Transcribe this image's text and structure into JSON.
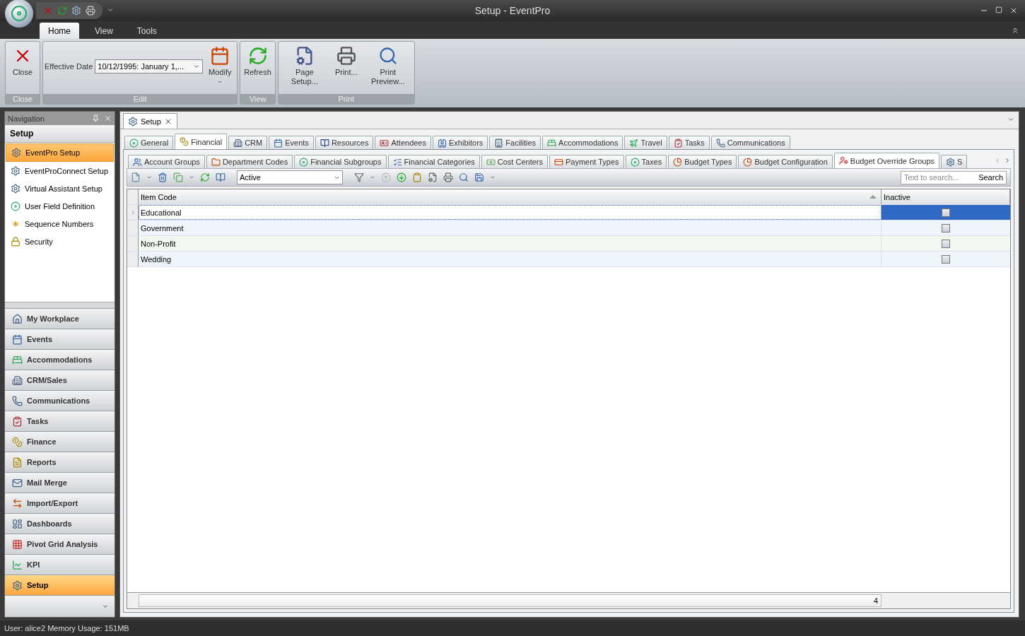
{
  "window": {
    "title": "Setup - EventPro"
  },
  "ribbon": {
    "tabs": [
      {
        "label": "Home",
        "selected": true
      },
      {
        "label": "View",
        "selected": false
      },
      {
        "label": "Tools",
        "selected": false
      }
    ],
    "groups": [
      {
        "caption": "Close",
        "items": [
          {
            "kind": "button",
            "label": "Close"
          }
        ]
      },
      {
        "caption": "Edit",
        "items": [
          {
            "kind": "date",
            "label": "Effective Date",
            "value": "10/12/1995: January 1,..."
          },
          {
            "kind": "button",
            "label": "Modify",
            "dropdown": true
          }
        ]
      },
      {
        "caption": "View",
        "items": [
          {
            "kind": "button",
            "label": "Refresh"
          }
        ]
      },
      {
        "caption": "Print",
        "items": [
          {
            "kind": "button",
            "label": "Page Setup..."
          },
          {
            "kind": "button",
            "label": "Print..."
          },
          {
            "kind": "button",
            "label": "Print Preview..."
          }
        ]
      }
    ]
  },
  "navigation": {
    "title": "Navigation",
    "section": "Setup",
    "items": [
      {
        "label": "EventPro Setup",
        "selected": true
      },
      {
        "label": "EventProConnect Setup",
        "selected": false
      },
      {
        "label": "Virtual Assistant Setup",
        "selected": false
      },
      {
        "label": "User Field Definition",
        "selected": false
      },
      {
        "label": "Sequence Numbers",
        "selected": false
      },
      {
        "label": "Security",
        "selected": false
      }
    ],
    "buttons": [
      {
        "label": "My Workplace",
        "selected": false
      },
      {
        "label": "Events",
        "selected": false
      },
      {
        "label": "Accommodations",
        "selected": false
      },
      {
        "label": "CRM/Sales",
        "selected": false
      },
      {
        "label": "Communications",
        "selected": false
      },
      {
        "label": "Tasks",
        "selected": false
      },
      {
        "label": "Finance",
        "selected": false
      },
      {
        "label": "Reports",
        "selected": false
      },
      {
        "label": "Mail Merge",
        "selected": false
      },
      {
        "label": "Import/Export",
        "selected": false
      },
      {
        "label": "Dashboards",
        "selected": false
      },
      {
        "label": "Pivot Grid Analysis",
        "selected": false
      },
      {
        "label": "KPI",
        "selected": false
      },
      {
        "label": "Setup",
        "selected": true
      }
    ]
  },
  "document_tab": {
    "label": "Setup"
  },
  "category_tabs": [
    {
      "label": "General",
      "selected": false
    },
    {
      "label": "Financial",
      "selected": true
    },
    {
      "label": "CRM",
      "selected": false
    },
    {
      "label": "Events",
      "selected": false
    },
    {
      "label": "Resources",
      "selected": false
    },
    {
      "label": "Attendees",
      "selected": false
    },
    {
      "label": "Exhibitors",
      "selected": false
    },
    {
      "label": "Facilities",
      "selected": false
    },
    {
      "label": "Accommodations",
      "selected": false
    },
    {
      "label": "Travel",
      "selected": false
    },
    {
      "label": "Tasks",
      "selected": false
    },
    {
      "label": "Communications",
      "selected": false
    }
  ],
  "sub_tabs": [
    {
      "label": "Account Groups",
      "selected": false
    },
    {
      "label": "Department Codes",
      "selected": false
    },
    {
      "label": "Financial Subgroups",
      "selected": false
    },
    {
      "label": "Financial Categories",
      "selected": false
    },
    {
      "label": "Cost Centers",
      "selected": false
    },
    {
      "label": "Payment Types",
      "selected": false
    },
    {
      "label": "Taxes",
      "selected": false
    },
    {
      "label": "Budget Types",
      "selected": false
    },
    {
      "label": "Budget Configuration",
      "selected": false
    },
    {
      "label": "Budget Override Groups",
      "selected": true
    },
    {
      "label": "S",
      "selected": false
    }
  ],
  "toolbar": {
    "filter": "Active",
    "search_placeholder": "Text to search...",
    "search_button": "Search"
  },
  "table": {
    "columns": [
      "Item Code",
      "Inactive"
    ],
    "rows": [
      {
        "item_code": "Educational",
        "inactive": false,
        "selected": true
      },
      {
        "item_code": "Government",
        "inactive": false,
        "selected": false
      },
      {
        "item_code": "Non-Profit",
        "inactive": false,
        "selected": false
      },
      {
        "item_code": "Wedding",
        "inactive": false,
        "selected": false
      }
    ],
    "footer": "4"
  },
  "status_bar": "User: alice2  Memory Usage: 151MB"
}
